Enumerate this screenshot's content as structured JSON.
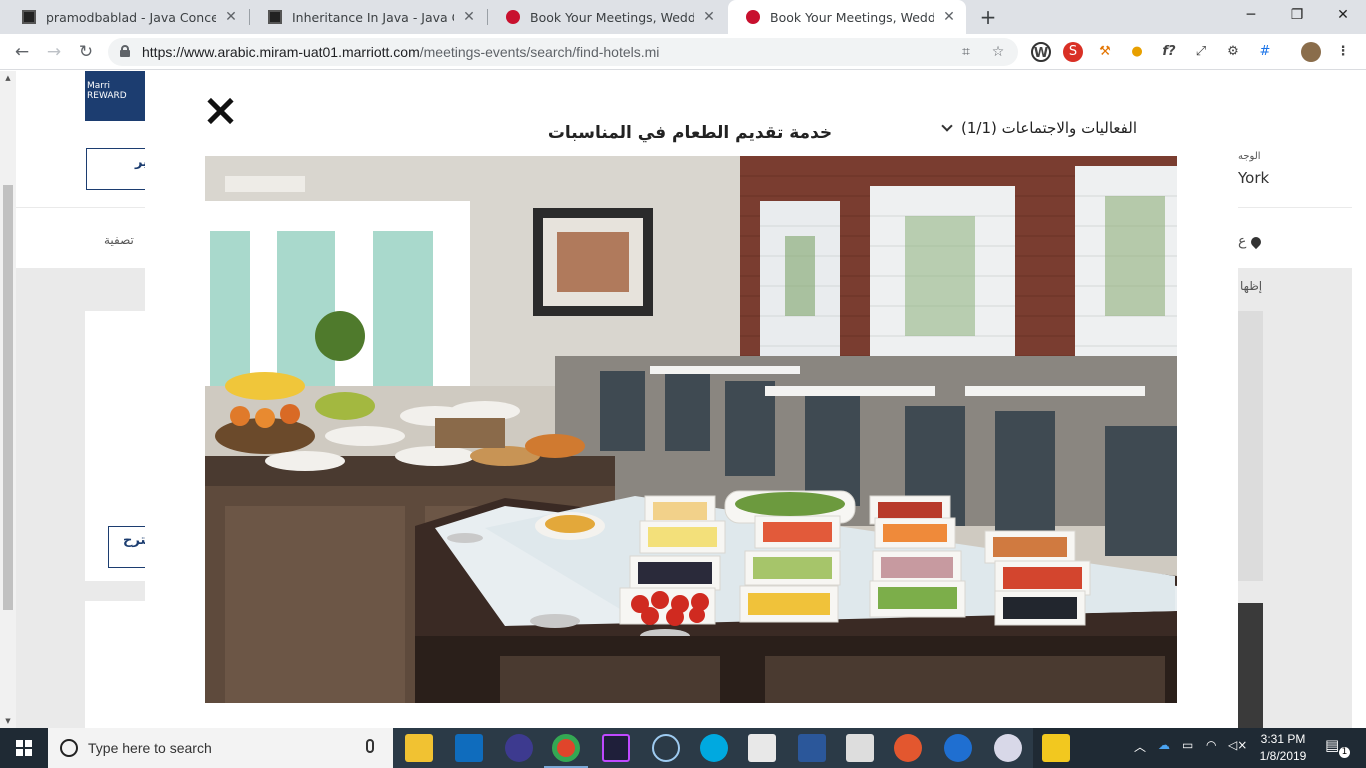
{
  "browser": {
    "tabs": [
      {
        "title": "pramodbablad - Java Concept Of",
        "favicon": "dark-square-icon",
        "active": false
      },
      {
        "title": "Inheritance In Java - Java Concep",
        "favicon": "dark-square-icon",
        "active": false
      },
      {
        "title": "Book Your Meetings, Weddings, &",
        "favicon": "marriott-icon",
        "active": false
      },
      {
        "title": "Book Your Meetings, Weddings, &",
        "favicon": "marriott-icon",
        "active": true
      }
    ],
    "url_host": "https://www.arabic.miram-uat01.marriott.com",
    "url_path": "/meetings-events/search/find-hotels.mi"
  },
  "page_background": {
    "brand_label": "Marri REWARD",
    "left_button_label": "ير",
    "right_destination_label": "الوجه",
    "right_destination_value": "York",
    "filter_label": "تصفية",
    "location_label": "ع",
    "show_label": "إظها",
    "suggest_button_label": "قترح"
  },
  "modal": {
    "title": "خدمة تقديم الطعام في المناسبات",
    "gallery_selector": "الفعاليات والاجتماعات (1/1)",
    "photo_description_name": "restaurant-buffet-photo"
  },
  "taskbar": {
    "search_placeholder": "Type here to search",
    "time": "3:31 PM",
    "date": "1/8/2019",
    "notification_count": "1"
  },
  "colors": {
    "marriott_red": "#c8102e",
    "brand_navy": "#1c3d70",
    "taskbar": "#1f2a34"
  }
}
